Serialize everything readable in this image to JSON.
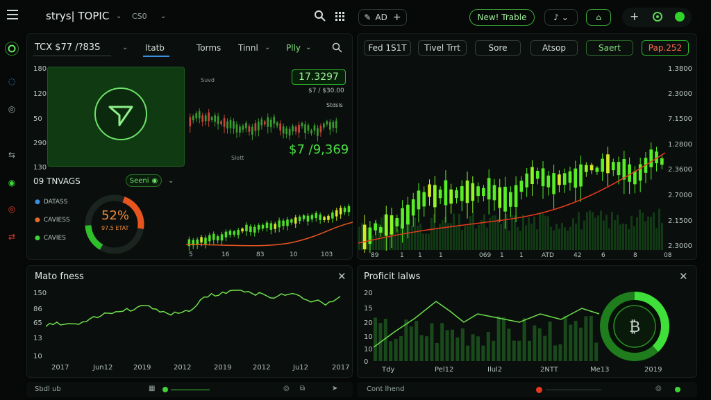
{
  "header": {
    "app_title": "strys| TOPIC",
    "selector": "CS0",
    "new_button": "New! Trable",
    "search_icon": "search-icon",
    "grid_icon": "grid-icon",
    "add_label": "AD",
    "alert_icon": "bell-icon",
    "status_color": "#2fd32a"
  },
  "left_panel": {
    "ticker": "TCX $77 /?83S",
    "tabs": [
      "Itatb",
      "Torms",
      "Tinnl",
      "Plly"
    ],
    "y_labels": [
      "180",
      "120",
      "50",
      "290",
      "130"
    ],
    "mini_price": "17.3297",
    "mini_sub": "$7 / $30.00",
    "mini_note": "Stdsls",
    "mini_value": "$7 /9,369",
    "mini_top": "Suvd",
    "mini_bottom": "Slott",
    "tiles": {
      "title": "09 TNVAGS",
      "select": "Seeni",
      "legend": [
        "DATASS",
        "CAVIESS",
        "CAVIES"
      ],
      "percent": "52%",
      "percent_sub": "97.5 ETAT",
      "percent_value": 0.52
    },
    "x_labels": [
      "5",
      "16",
      "83",
      "10",
      "103"
    ]
  },
  "right_panel": {
    "buttons": [
      "Fed 1S1T",
      "Tivel Trrt",
      "Sore",
      "Atsop",
      "Saert",
      "Pap.252"
    ],
    "y_labels": [
      "1.3800",
      "2.3000",
      "7.1500",
      "1.2800",
      "2.3600",
      "2.7000",
      "2.1500",
      "2.3000"
    ],
    "x_labels": [
      "89",
      "1",
      "1",
      "1",
      "069",
      "1",
      "1",
      "ATD",
      "42",
      "6",
      "8",
      "08"
    ]
  },
  "bottom_left": {
    "title": "Mato fness",
    "y_labels": [
      "150",
      "86",
      "65",
      "13",
      "10"
    ],
    "x_labels": [
      "2017",
      "Jun12",
      "2019",
      "2012",
      "2019",
      "2012",
      "Ju12",
      "2017"
    ],
    "footer": "Sbdl ub"
  },
  "bottom_right": {
    "title": "Proficit lalws",
    "y_labels": [
      "20",
      "15",
      "20",
      "10",
      "10",
      "0"
    ],
    "x_labels": [
      "Tdy",
      "Pel12",
      "Ilul2",
      "2NTT",
      "Me13",
      "2019"
    ],
    "footer": "Cont lhend"
  }
}
